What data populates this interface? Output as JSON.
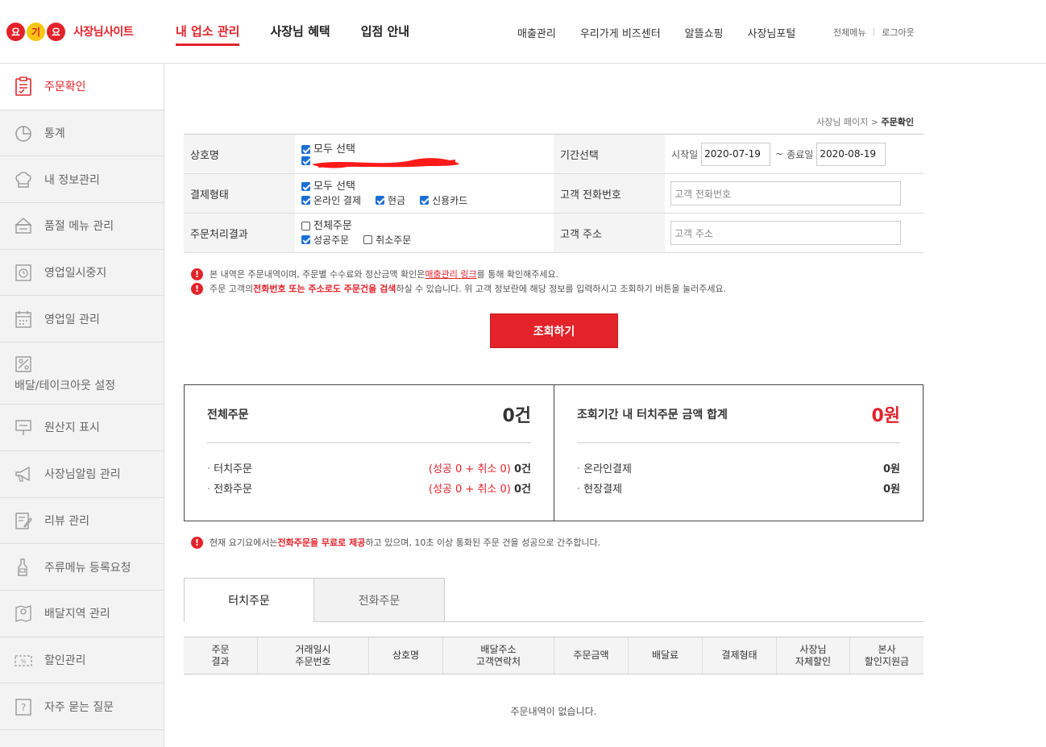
{
  "header": {
    "logo": {
      "syllables": [
        "요",
        "기",
        "요"
      ],
      "text": "사장님사이트"
    },
    "gnb": [
      {
        "label": "내 업소 관리",
        "active": true
      },
      {
        "label": "사장님 혜택",
        "active": false
      },
      {
        "label": "입점 안내",
        "active": false
      }
    ],
    "top_links": [
      "매출관리",
      "우리가게 비즈센터",
      "알뜰쇼핑",
      "사장님포털"
    ],
    "util": {
      "all_menu": "전체메뉴",
      "logout": "로그아웃"
    }
  },
  "sidebar": {
    "items": [
      {
        "label": "주문확인",
        "icon": "clipboard-icon",
        "active": true
      },
      {
        "label": "통계",
        "icon": "pie-chart-icon"
      },
      {
        "label": "내 정보관리",
        "icon": "chef-hat-icon"
      },
      {
        "label": "품절 메뉴 관리",
        "icon": "soldout-sign-icon"
      },
      {
        "label": "영업일시중지",
        "icon": "pause-clock-icon"
      },
      {
        "label": "영업일 관리",
        "icon": "calendar-icon"
      },
      {
        "label": "배달/테이크아웃 설정",
        "icon": "delivery-settings-icon"
      },
      {
        "label": "원산지 표시",
        "icon": "origin-sign-icon"
      },
      {
        "label": "사장님알림 관리",
        "icon": "megaphone-icon"
      },
      {
        "label": "리뷰 관리",
        "icon": "review-edit-icon"
      },
      {
        "label": "주류메뉴 등록요청",
        "icon": "bottle-icon"
      },
      {
        "label": "배달지역 관리",
        "icon": "map-pin-icon"
      },
      {
        "label": "할인관리",
        "icon": "discount-ticket-icon"
      },
      {
        "label": "자주 묻는 질문",
        "icon": "question-icon"
      }
    ]
  },
  "breadcrumb": {
    "home": "사장님 페이지",
    "sep": ">",
    "current": "주문확인"
  },
  "form": {
    "store_label": "상호명",
    "store_all": "모두 선택",
    "period_label": "기간선택",
    "start_label": "시작일",
    "start_value": "2020-07-19",
    "tilde": "~",
    "end_label": "종료일",
    "end_value": "2020-08-19",
    "pay_label": "결제형태",
    "pay_all": "모두 선택",
    "pay_online": "온라인 결제",
    "pay_cash": "현금",
    "pay_card": "신용카드",
    "phone_label": "고객 전화번호",
    "phone_placeholder": "고객 전화번호",
    "result_label": "주문처리결과",
    "result_all": "전체주문",
    "result_success": "성공주문",
    "result_cancel": "취소주문",
    "address_label": "고객 주소",
    "address_placeholder": "고객 주소"
  },
  "notices": {
    "n1_a": "본 내역은 주문내역이며, 주문별 수수료와 정산금액 확인은 ",
    "n1_link": "매출관리 링크",
    "n1_b": "를 통해 확인해주세요.",
    "n2_a": "주문 고객의 ",
    "n2_red": "전화번호 또는 주소로도 주문건을 검색",
    "n2_b": "하실 수 있습니다. 위 고객 정보란에 해당 정보를 입력하시고 조회하기 버튼을 눌러주세요."
  },
  "search_button": "조회하기",
  "summary": {
    "left": {
      "title": "전체주문",
      "total": "0건",
      "rows": [
        {
          "label": "터치주문",
          "detail": "(성공 0 + 취소 0)",
          "value": "0건"
        },
        {
          "label": "전화주문",
          "detail": "(성공 0 + 취소 0)",
          "value": "0건"
        }
      ]
    },
    "right": {
      "title": "조회기간 내 터치주문 금액 합계",
      "total": "0원",
      "rows": [
        {
          "label": "온라인결제",
          "value": "0원"
        },
        {
          "label": "현장결제",
          "value": "0원"
        }
      ]
    }
  },
  "notice3": {
    "a": "현재 요기요에서는 ",
    "red": "전화주문을 무료로 제공",
    "b": "하고 있으며, 10초 이상 통화된 주문 건을 성공으로 간주합니다."
  },
  "tabs": [
    {
      "label": "터치주문",
      "active": true
    },
    {
      "label": "전화주문",
      "active": false
    }
  ],
  "grid": {
    "columns": [
      "주문\n결과",
      "거래일시\n주문번호",
      "상호명",
      "배달주소\n고객연락처",
      "주문금액",
      "배달료",
      "결제형태",
      "사장님\n자체할인",
      "본사\n할인지원금"
    ],
    "empty": "주문내역이 없습니다."
  },
  "colors": {
    "accent": "#e3222a",
    "logo_yellow": "#fac611",
    "checkbox": "#1a6fd6"
  }
}
